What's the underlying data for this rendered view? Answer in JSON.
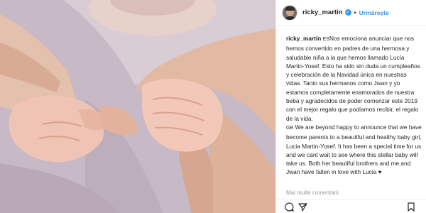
{
  "post": {
    "username": "ricky_martin",
    "verified_badge": "✓",
    "separator": "•",
    "follow_label": "Urmărește",
    "caption": {
      "author": "ricky_martin",
      "text_es": "Nos emociona anunciar que nos hemos convertido en padres de una hermosa y saludable niña a la que hemos llamado Lucía Martin-Yosef. Esto ha sido sin duda un cumpleaños y celebración de la Navidad única en nuestras vidas. Tanto sus hermanos como Jwan y yo estamos completamente enamorados de nuestra beba y agradecidos de poder comenzar este 2019 con el mejor regalo que podíamos recibir, el regalo de la vida.",
      "flag_es": "ES",
      "flag_gb": "GB",
      "text_en": "We are beyond happy to announce that we have become parents to a beautiful and healthy baby girl, Lucia Martin-Yosef. It has been a special time for us and we cant wait to see where this stellar baby will take us. Both her beautiful brothers and me and Jwan have fallen in love with Lucia",
      "heart": "♥"
    },
    "more_comments_label": "Mai multe comentarii"
  },
  "icons": {
    "comment": "comment-icon",
    "share": "share-icon",
    "bookmark": "bookmark-icon",
    "verified": "verified-icon"
  },
  "colors": {
    "link_blue": "#3897f0",
    "text": "#262626",
    "muted": "#999999"
  }
}
